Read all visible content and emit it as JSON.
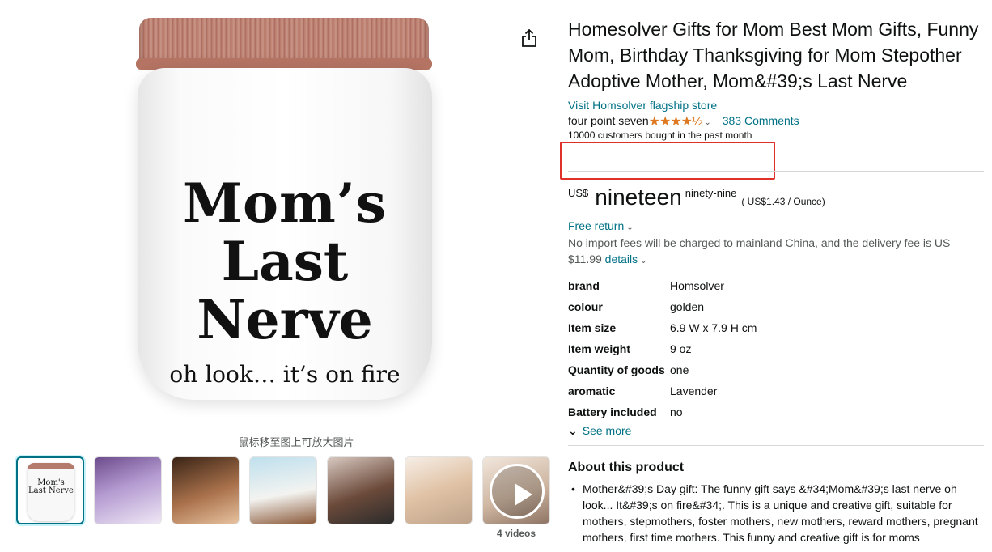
{
  "product": {
    "title": "Homesolver Gifts for Mom Best Mom Gifts, Funny Mom, Birthday Thanksgiving for Mom Stepother Adoptive Mother, Mom&#39;s Last Nerve",
    "store_link": "Visit Homsolver flagship store",
    "rating_text": "four point seven",
    "stars": "★★★★½",
    "rating_value": 4.7,
    "comments": "383 Comments",
    "bought": "10000 customers bought in the past month"
  },
  "image": {
    "jar_lines": [
      "Mom’s",
      "Last",
      "Nerve",
      "oh look… it’s on fire"
    ],
    "zoom_hint": "鼠标移至图上可放大图片",
    "mini_jar_text": "Mom's Last Nerve",
    "video_count": "4 videos"
  },
  "price": {
    "currency": "US$",
    "whole": "nineteen",
    "fraction": "ninety-nine",
    "unit_price": "( US$1.43 / Ounce)"
  },
  "shipping": {
    "free_return": "Free return",
    "delivery_text": "No import fees will be charged to mainland China, and the delivery fee is US $11.99",
    "details": "details"
  },
  "specs": [
    {
      "key": "brand",
      "value": "Homsolver"
    },
    {
      "key": "colour",
      "value": "golden"
    },
    {
      "key": "Item size",
      "value": "6.9 W x 7.9 H cm"
    },
    {
      "key": "Item weight",
      "value": "9 oz"
    },
    {
      "key": "Quantity of goods",
      "value": "one"
    },
    {
      "key": "aromatic",
      "value": "Lavender"
    },
    {
      "key": "Battery included",
      "value": "no"
    }
  ],
  "see_more": "See more",
  "about": {
    "heading": "About this product",
    "bullets": [
      "Mother&#39;s Day gift: The funny gift says &#34;Mom&#39;s last nerve oh look... It&#39;s on fire&#34;. This is a unique and creative gift, suitable for mothers, stepmothers, foster mothers, new mothers, reward mothers, pregnant mothers, first time mothers. This funny and creative gift is for moms"
    ]
  },
  "colors": {
    "link": "#007185",
    "star": "#de7921",
    "highlight": "#e0302a"
  }
}
